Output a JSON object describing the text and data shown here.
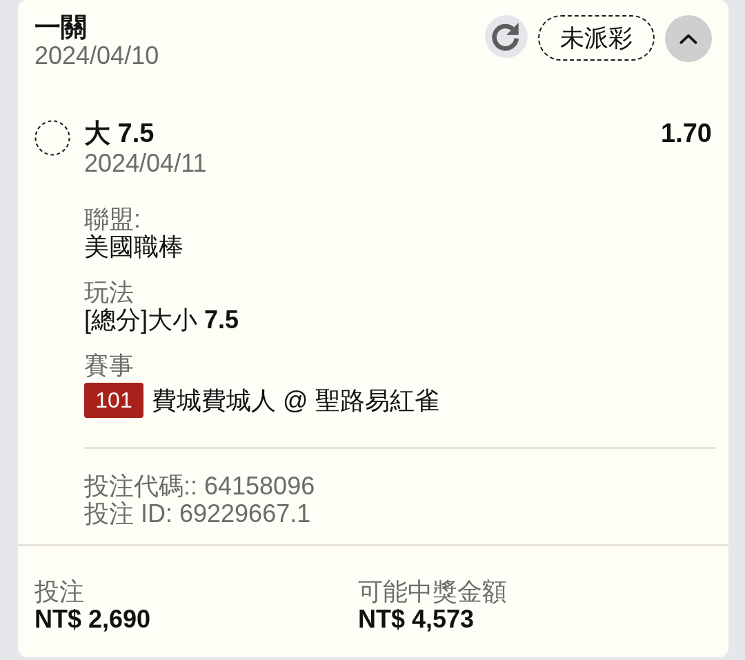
{
  "bet": {
    "title": "一關",
    "date": "2024/04/10",
    "status_badge": "未派彩",
    "expanded": true
  },
  "selection": {
    "pick": "大 7.5",
    "odds": "1.70",
    "date": "2024/04/11"
  },
  "details": [
    {
      "label": "聯盟:",
      "value": "美國職棒"
    },
    {
      "label": "玩法",
      "value": "[總分]大小 **7.5**"
    },
    {
      "label": "賽事",
      "badge": "101",
      "value": "費城費城人 @ 聖路易紅雀"
    }
  ],
  "references": [
    "投注代碼:: 64158096",
    "投注 ID: 69229667.1"
  ],
  "summary": [
    {
      "label": "投注",
      "value": "NT$ 2,690"
    },
    {
      "label": "可能中獎金額",
      "value": "NT$ 4,573"
    }
  ]
}
